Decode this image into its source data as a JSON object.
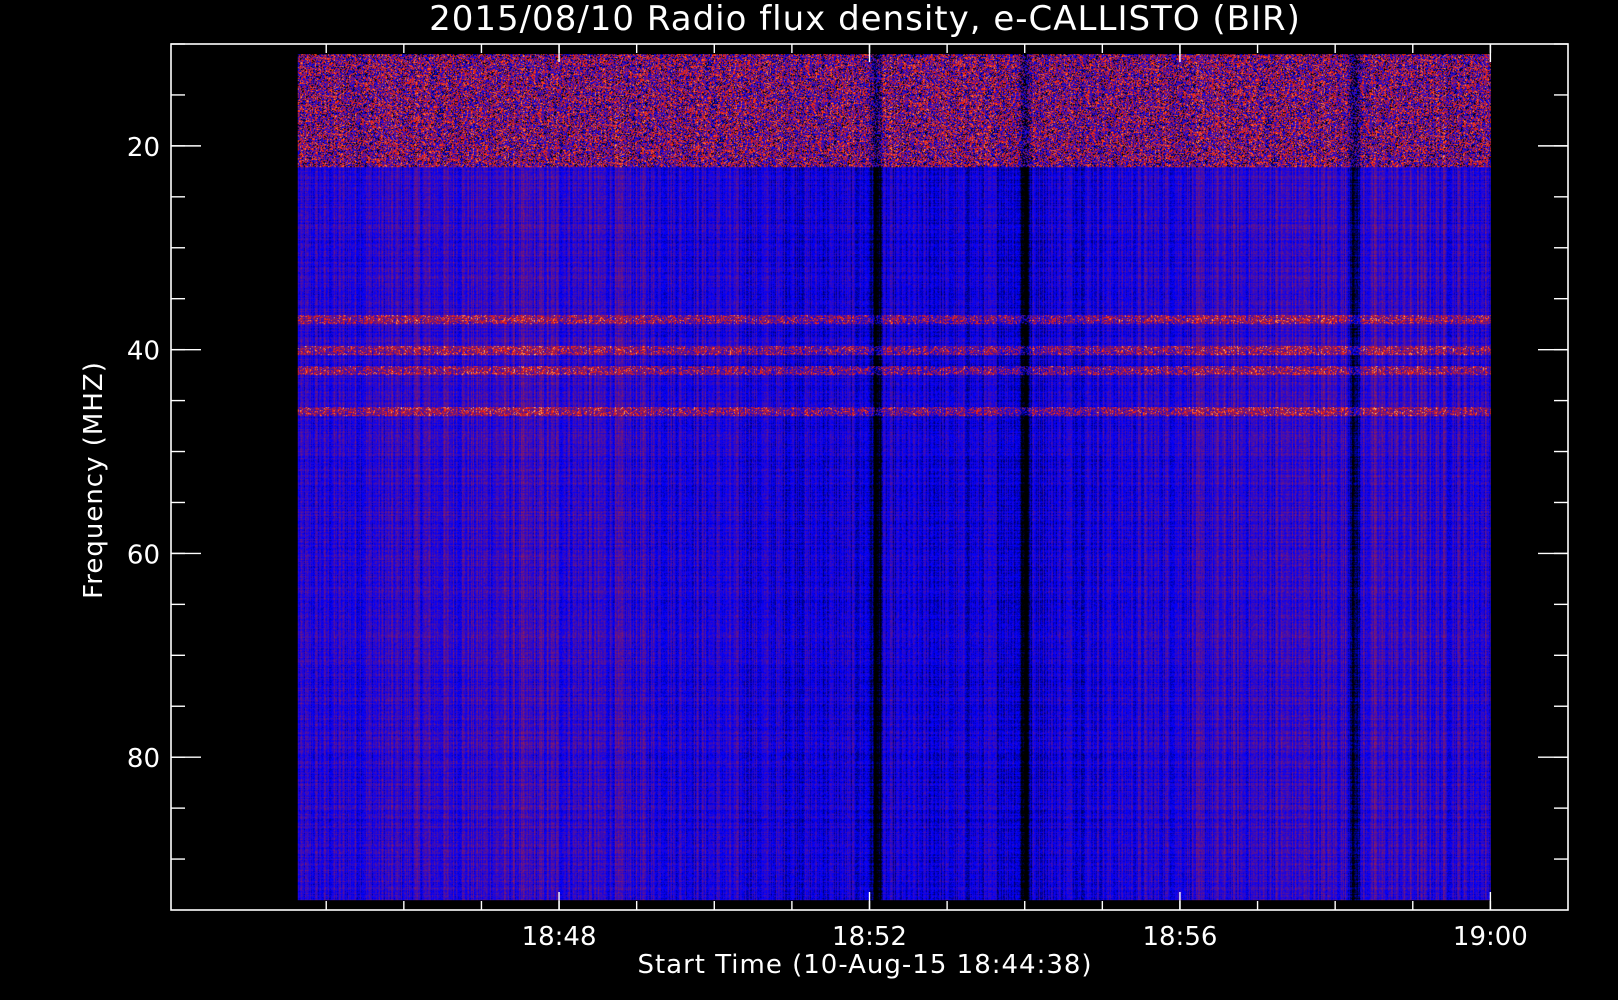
{
  "chart_data": {
    "type": "heatmap",
    "title": "2015/08/10  Radio flux density, e-CALLISTO (BIR)",
    "xlabel": "Start Time (10-Aug-15 18:44:38)",
    "ylabel": "Frequency (MHZ)",
    "x_start": "18:44:38",
    "x_end": "19:00:00",
    "xlim": [
      "18:43",
      "19:01"
    ],
    "ylim": [
      95,
      10
    ],
    "y_data_range": [
      11,
      94
    ],
    "x_major_ticks": [
      "18:48",
      "18:52",
      "18:56",
      "19:00"
    ],
    "x_minor_ticks": [
      "18:45",
      "18:46",
      "18:47",
      "18:48",
      "18:49",
      "18:50",
      "18:51",
      "18:52",
      "18:53",
      "18:54",
      "18:55",
      "18:56",
      "18:57",
      "18:58",
      "18:59",
      "19:00"
    ],
    "y_major_ticks": [
      20,
      40,
      60,
      80
    ],
    "y_minor_ticks": [
      10,
      15,
      20,
      25,
      30,
      35,
      40,
      45,
      50,
      55,
      60,
      65,
      70,
      75,
      80,
      85,
      90
    ],
    "colormap": [
      "#000000",
      "#0000ff",
      "#7f1a6a",
      "#ff2000",
      "#ffd27a"
    ],
    "features": [
      {
        "kind": "rfi_band",
        "freq_range": [
          11,
          22
        ]
      },
      {
        "kind": "rfi_line",
        "freq": 37
      },
      {
        "kind": "rfi_line",
        "freq": 40
      },
      {
        "kind": "rfi_line",
        "freq": 42
      },
      {
        "kind": "rfi_line",
        "freq": 46
      },
      {
        "kind": "dark_column",
        "time": "18:54:00"
      },
      {
        "kind": "dark_column",
        "time": "18:52:05"
      },
      {
        "kind": "dark_column",
        "time": "18:58:15"
      }
    ]
  }
}
